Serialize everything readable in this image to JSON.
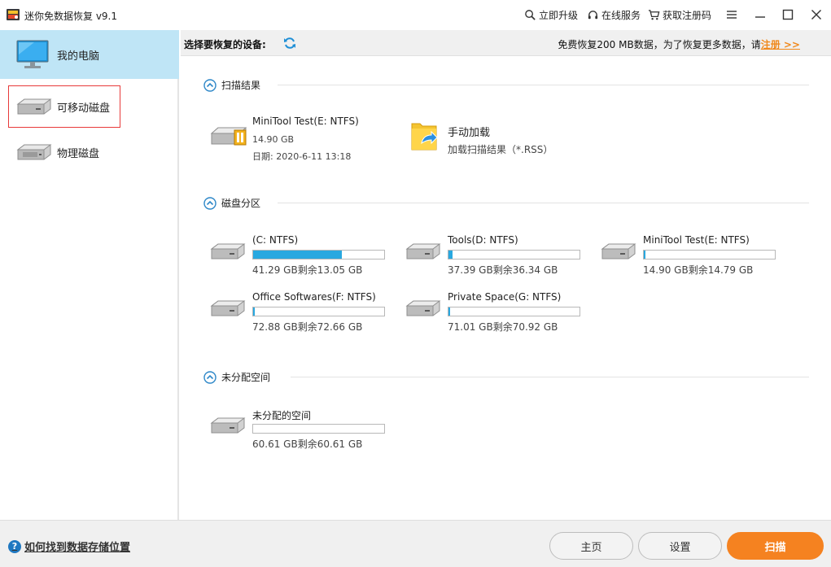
{
  "window": {
    "title": "迷你免数据恢复 v9.1",
    "links": [
      "立即升级",
      "在线服务",
      "获取注册码"
    ]
  },
  "sidebar": {
    "items": [
      {
        "label": "我的电脑",
        "icon": "monitor-icon",
        "active": true
      },
      {
        "label": "可移动磁盘",
        "icon": "removable-drive-icon",
        "highlight": true
      },
      {
        "label": "物理磁盘",
        "icon": "physical-disk-icon"
      }
    ]
  },
  "header": {
    "select_label": "选择要恢复的设备:",
    "free_notice": "免费恢复200 MB数据，为了恢复更多数据，请",
    "register_link": "注册 >>"
  },
  "scan_results": {
    "title": "扫描结果",
    "item": {
      "name": "MiniTool Test(E: NTFS)",
      "size": "14.90 GB",
      "date": "日期:  2020-6-11 13:18"
    },
    "manual_load": {
      "title": "手动加载",
      "desc": "加载扫描结果（*.RSS）"
    }
  },
  "partitions": {
    "title": "磁盘分区",
    "drives": [
      {
        "name": "(C: NTFS)",
        "size": "41.29 GB剩余13.05 GB",
        "used_fraction": 0.68
      },
      {
        "name": "Tools(D: NTFS)",
        "size": "37.39 GB剩余36.34 GB",
        "used_fraction": 0.028
      },
      {
        "name": "MiniTool Test(E: NTFS)",
        "size": "14.90 GB剩余14.79 GB",
        "used_fraction": 0.007
      },
      {
        "name": "Office Softwares(F: NTFS)",
        "size": "72.88 GB剩余72.66 GB",
        "used_fraction": 0.003
      },
      {
        "name": "Private Space(G: NTFS)",
        "size": "71.01 GB剩余70.92 GB",
        "used_fraction": 0.001
      }
    ]
  },
  "unallocated": {
    "title": "未分配空间",
    "item": {
      "name": "未分配的空间",
      "size": "60.61 GB剩余60.61 GB",
      "used_fraction": 0
    }
  },
  "footer": {
    "help_text": "如何找到数据存储位置",
    "home_button": "主页",
    "settings_button": "设置",
    "scan_button": "扫描"
  },
  "colors": {
    "accent": "#f58220",
    "selected": "#bfe5f6",
    "bar_fill": "#28a8e0",
    "link": "#f0891d"
  }
}
